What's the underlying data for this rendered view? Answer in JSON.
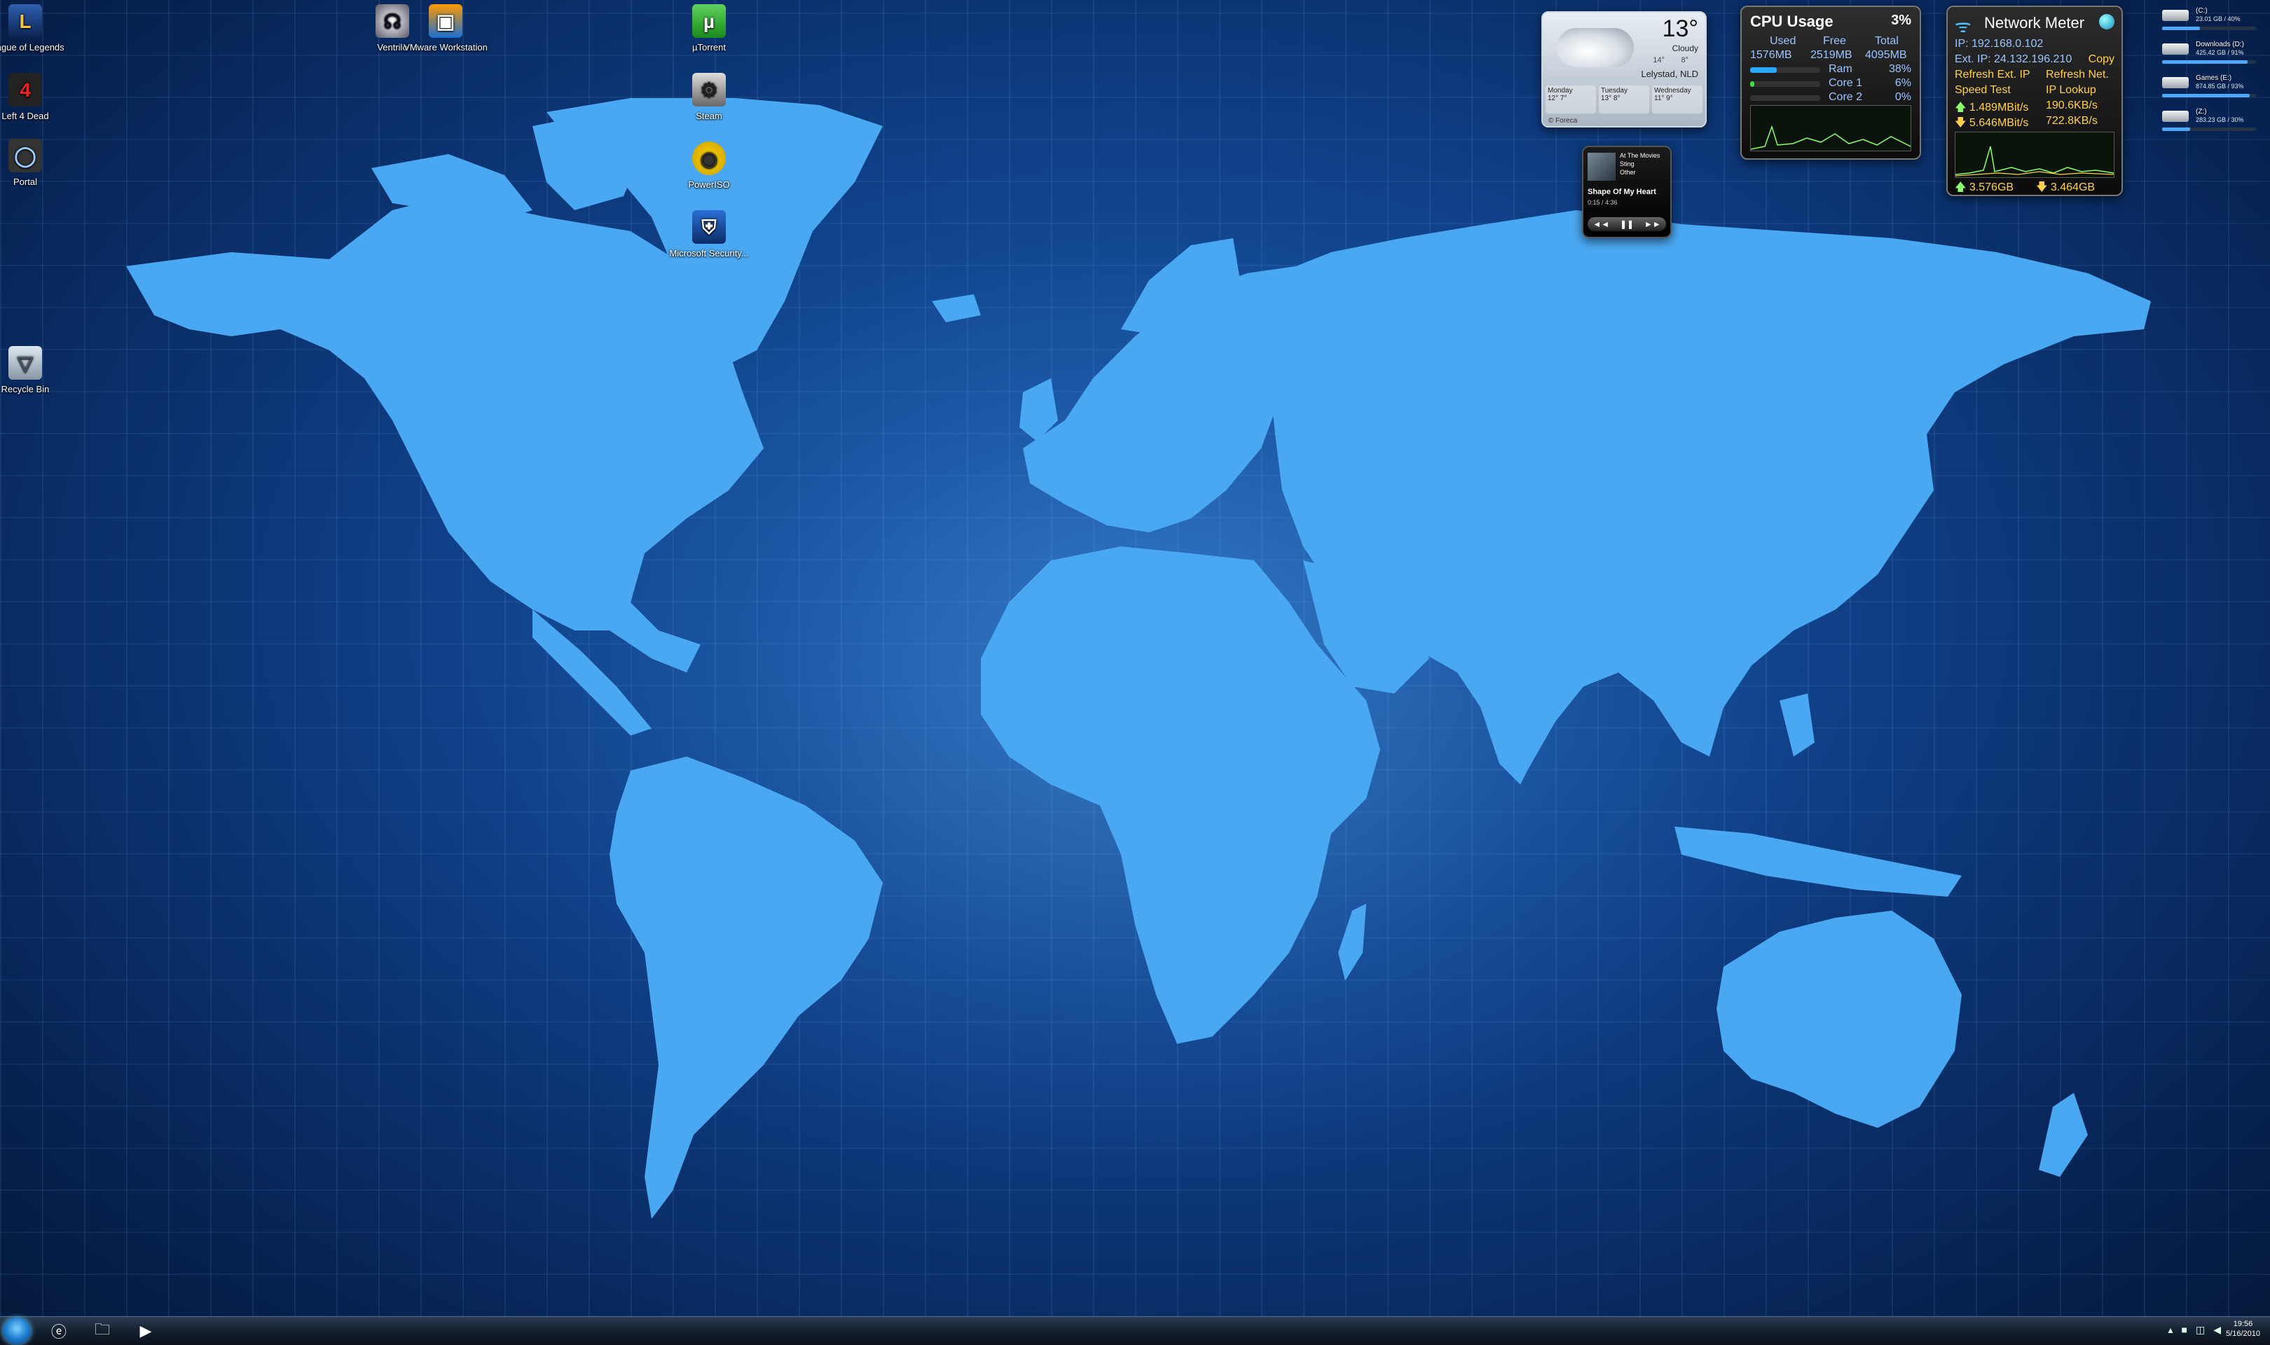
{
  "desktop_icons": [
    {
      "label": "League of Legends",
      "icon": "league-of-legends-icon"
    },
    {
      "label": "Left 4 Dead",
      "icon": "left-4-dead-icon"
    },
    {
      "label": "Portal",
      "icon": "portal-icon"
    },
    {
      "label": "Recycle Bin",
      "icon": "recycle-bin-icon"
    },
    {
      "label": "Ventrilo",
      "icon": "ventrilo-icon"
    },
    {
      "label": "VMware Workstation",
      "icon": "vmware-icon"
    },
    {
      "label": "µTorrent",
      "icon": "utorrent-icon"
    },
    {
      "label": "Steam",
      "icon": "steam-icon"
    },
    {
      "label": "PowerISO",
      "icon": "poweriso-icon"
    },
    {
      "label": "Microsoft Security...",
      "icon": "microsoft-security-icon"
    }
  ],
  "weather": {
    "temp": "13°",
    "condition": "Cloudy",
    "hi": "14°",
    "lo": "8°",
    "city": "Lelystad, NLD",
    "days": [
      {
        "name": "Monday",
        "hi": "12°",
        "lo": "7°"
      },
      {
        "name": "Tuesday",
        "hi": "13°",
        "lo": "8°"
      },
      {
        "name": "Wednesday",
        "hi": "11°",
        "lo": "9°"
      }
    ],
    "source": "© Foreca"
  },
  "media": {
    "line1": "At The Movies",
    "artist": "Sting",
    "album": "Other",
    "song": "Shape Of My Heart",
    "time": "0:15 / 4:36",
    "controls": [
      "◄◄",
      "❚❚",
      "►►"
    ]
  },
  "cpu": {
    "title": "CPU Usage",
    "percent": "3%",
    "headers": [
      "Used",
      "Free",
      "Total"
    ],
    "values": [
      "1576MB",
      "2519MB",
      "4095MB"
    ],
    "ram_label": "Ram",
    "ram_value": "38%",
    "ram_fraction": 0.38,
    "core1_label": "Core 1",
    "core1_value": "6%",
    "core1_fraction": 0.06,
    "core2_label": "Core 2",
    "core2_value": "0%",
    "core2_fraction": 0.0,
    "graph_color": "#8dff6a"
  },
  "network": {
    "title": "Network Meter",
    "ip": "IP: 192.168.0.102",
    "ext_ip": "Ext. IP: 24.132.196.210",
    "copy": "Copy",
    "refresh_ext": "Refresh Ext. IP",
    "refresh_net": "Refresh Net.",
    "speed_test": "Speed Test",
    "ip_lookup": "IP Lookup",
    "up_rate": "1.489MBit/s",
    "up_kb": "190.6KB/s",
    "down_rate": "5.646MBit/s",
    "down_kb": "722.8KB/s",
    "up_total": "3.576GB",
    "down_total": "3.464GB"
  },
  "drives": [
    {
      "name": "(C:)",
      "info": "23.01 GB / 40%",
      "fraction": 0.4
    },
    {
      "name": "Downloads (D:)",
      "info": "425.42 GB / 91%",
      "fraction": 0.91
    },
    {
      "name": "Games (E:)",
      "info": "874.85 GB / 93%",
      "fraction": 0.93
    },
    {
      "name": "(Z:)",
      "info": "283.23 GB / 30%",
      "fraction": 0.3
    }
  ],
  "taskbar": {
    "time": "19:56",
    "date": "5/16/2010"
  }
}
